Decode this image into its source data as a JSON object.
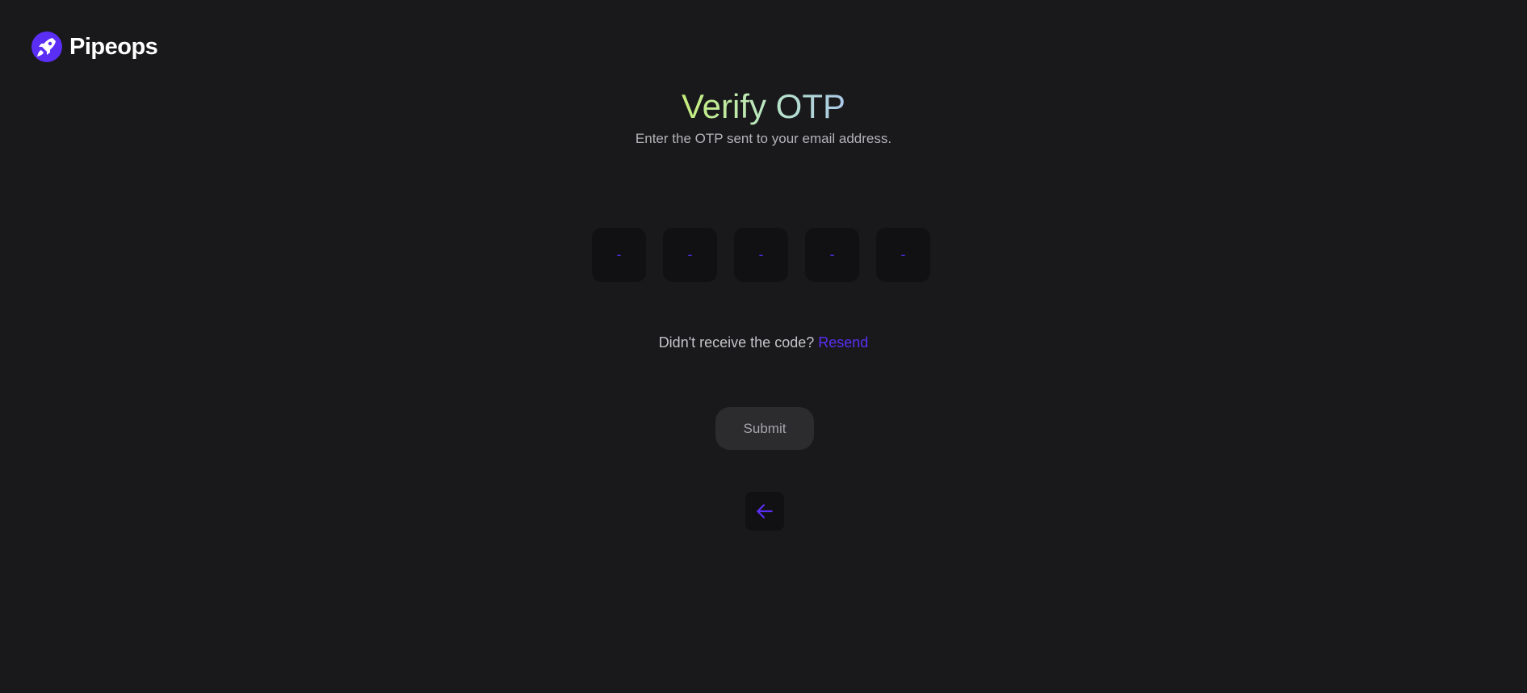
{
  "brand": {
    "name": "Pipeops",
    "accent_color": "#5b2ef5"
  },
  "header": {
    "title": "Verify OTP",
    "subtitle": "Enter the OTP sent to your email address."
  },
  "otp": {
    "digits": [
      {
        "value": "",
        "placeholder": "-"
      },
      {
        "value": "",
        "placeholder": "-"
      },
      {
        "value": "",
        "placeholder": "-"
      },
      {
        "value": "",
        "placeholder": "-"
      },
      {
        "value": "",
        "placeholder": "-"
      }
    ]
  },
  "resend": {
    "prompt": "Didn't receive the code?",
    "link_label": "Resend"
  },
  "actions": {
    "submit_label": "Submit",
    "back_icon": "arrow-left-icon"
  }
}
